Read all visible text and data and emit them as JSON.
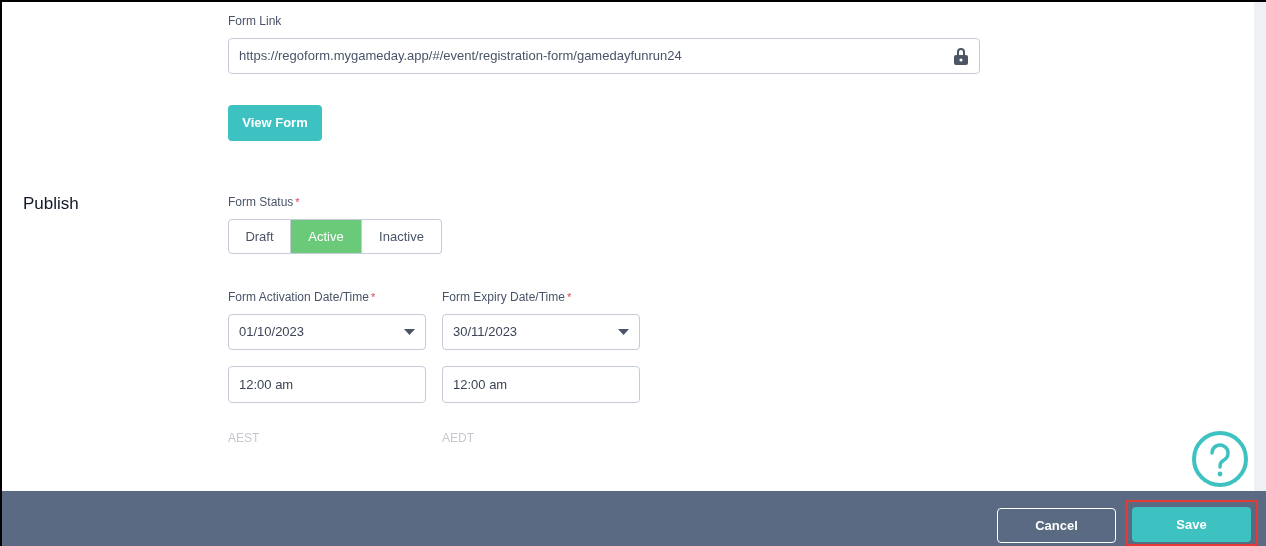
{
  "form_link": {
    "label": "Form Link",
    "value": "https://regoform.mygameday.app/#/event/registration-form/gamedayfunrun24"
  },
  "view_form_button": "View Form",
  "section_title": "Publish",
  "form_status": {
    "label": "Form Status",
    "required_mark": "*",
    "options": [
      {
        "label": "Draft",
        "selected": false
      },
      {
        "label": "Active",
        "selected": true
      },
      {
        "label": "Inactive",
        "selected": false
      }
    ]
  },
  "date_fields": [
    {
      "label": "Form Activation Date/Time",
      "required_mark": "*",
      "date": "01/10/2023",
      "time": "12:00 am",
      "timezone": "AEST"
    },
    {
      "label": "Form Expiry Date/Time",
      "required_mark": "*",
      "date": "30/11/2023",
      "time": "12:00 am",
      "timezone": "AEDT"
    }
  ],
  "footer": {
    "cancel": "Cancel",
    "save": "Save"
  }
}
